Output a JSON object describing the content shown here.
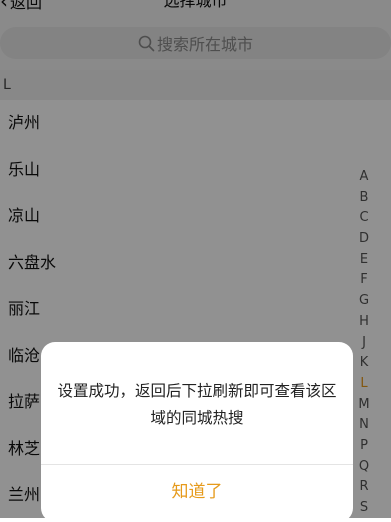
{
  "header": {
    "back_label": "返回",
    "title": "选择城市"
  },
  "search": {
    "placeholder": "搜索所在城市"
  },
  "section_letter": "L",
  "cities": [
    "泸州",
    "乐山",
    "凉山",
    "六盘水",
    "丽江",
    "临沧",
    "拉萨",
    "林芝",
    "兰州"
  ],
  "index_letters": [
    "A",
    "B",
    "C",
    "D",
    "E",
    "F",
    "G",
    "H",
    "J",
    "K",
    "L",
    "M",
    "N",
    "P",
    "Q",
    "R",
    "S"
  ],
  "active_letter": "L",
  "dialog": {
    "message": "设置成功，返回后下拉刷新即可查看该区域的同城热搜",
    "confirm_label": "知道了"
  },
  "colors": {
    "accent": "#e69a1b",
    "mask": "rgba(0,0,0,0.43)"
  },
  "icons": {
    "back": "chevron-left-icon",
    "search": "search-icon"
  }
}
